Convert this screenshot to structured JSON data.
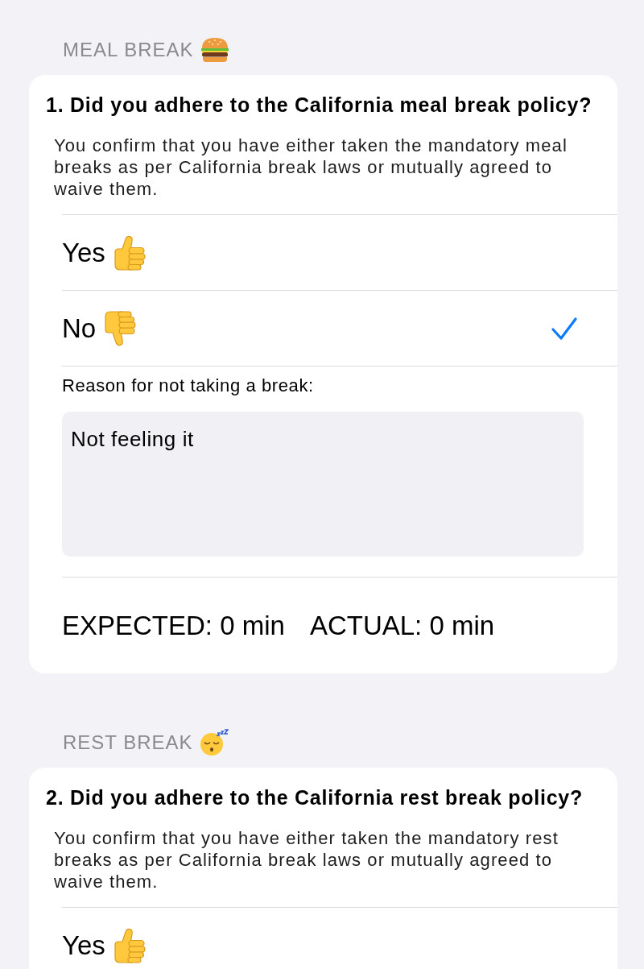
{
  "sections": [
    {
      "header": "MEAL BREAK",
      "kind": "meal",
      "question": {
        "title": "1. Did you adhere to the California meal break policy?",
        "description": "You confirm that you have either taken the mandatory meal breaks as per California break laws or mutually agreed to waive them.",
        "options": [
          {
            "label": "Yes",
            "kind": "positive",
            "selected": false
          },
          {
            "label": "No",
            "kind": "negative",
            "selected": true
          }
        ],
        "reason": {
          "label": "Reason for not taking a break:",
          "value": "Not feeling it"
        },
        "totals": {
          "expected": "EXPECTED: 0 min",
          "actual": "ACTUAL: 0 min"
        }
      }
    },
    {
      "header": "REST BREAK",
      "kind": "rest",
      "question": {
        "title": "2. Did you adhere to the California rest break policy?",
        "description": "You confirm that you have either taken the mandatory rest breaks as per California break laws or mutually agreed to waive them.",
        "options": [
          {
            "label": "Yes",
            "kind": "positive",
            "selected": false
          }
        ]
      }
    }
  ]
}
